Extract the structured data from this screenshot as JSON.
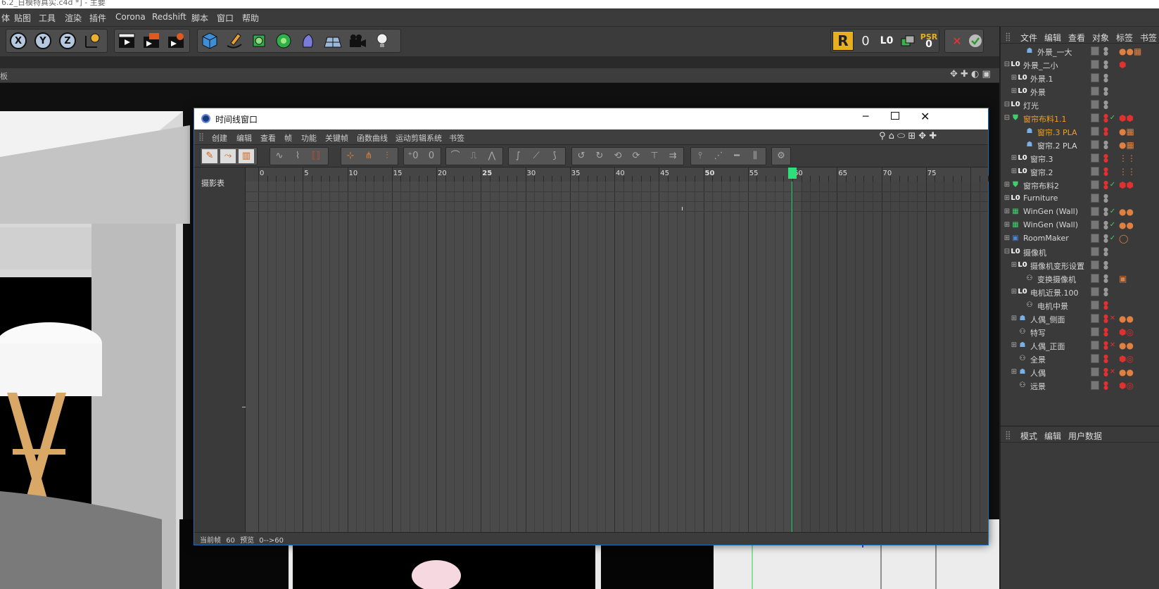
{
  "app": {
    "window_title": "6.2_日模特真实.c4d *] - 主要",
    "menus": [
      "体",
      "贴图",
      "工具",
      "渲染",
      "插件",
      "Corona",
      "Redshift",
      "脚本",
      "窗口",
      "帮助"
    ]
  },
  "toolbar": {
    "axis_x": "X",
    "axis_y": "Y",
    "axis_z": "Z",
    "right_group": {
      "frame_count": "0",
      "psr_label": "PSR",
      "psr_value": "0"
    }
  },
  "viewport": {
    "panel_label": "板"
  },
  "object_manager": {
    "menus": [
      "文件",
      "编辑",
      "查看",
      "对象",
      "标签",
      "书签"
    ],
    "items": [
      {
        "name": "外景_一大"
      },
      {
        "name": "外景_二小"
      },
      {
        "name": "外景.1"
      },
      {
        "name": "外景"
      },
      {
        "name": "灯光"
      },
      {
        "name": "窗帘布料1.1"
      },
      {
        "name": "窗帘.3 PLA"
      },
      {
        "name": "窗帘.2 PLA"
      },
      {
        "name": "窗帘.3"
      },
      {
        "name": "窗帘.2"
      },
      {
        "name": "窗帘布料2"
      },
      {
        "name": "Furniture"
      },
      {
        "name": "WinGen (Wall)"
      },
      {
        "name": "WinGen (Wall)"
      },
      {
        "name": "RoomMaker"
      },
      {
        "name": "摄像机"
      },
      {
        "name": "摄像机变形设置"
      },
      {
        "name": "变换摄像机"
      },
      {
        "name": "电机近景.100"
      },
      {
        "name": "电机中景"
      },
      {
        "name": "人偶_侧面"
      },
      {
        "name": "特写"
      },
      {
        "name": "人偶_正面"
      },
      {
        "name": "全景"
      },
      {
        "name": "人偶"
      },
      {
        "name": "远景"
      }
    ]
  },
  "attribute_manager": {
    "menus": [
      "模式",
      "编辑",
      "用户数据"
    ]
  },
  "timeline": {
    "title": "时间线窗口",
    "menus": [
      "创建",
      "编辑",
      "查看",
      "帧",
      "功能",
      "关键帧",
      "函数曲线",
      "运动剪辑系统",
      "书签"
    ],
    "left_label": "摄影表",
    "ruler_ticks": [
      "0",
      "5",
      "10",
      "15",
      "20",
      "25",
      "30",
      "35",
      "40",
      "45",
      "50",
      "55",
      "60",
      "65",
      "70",
      "75"
    ],
    "current_frame": "60",
    "status": {
      "current_frame_label": "当前帧",
      "current_frame_value": "60",
      "preview_label": "预览",
      "preview_range": "0-->60"
    }
  },
  "colors": {
    "accent_playhead": "#2ee07a",
    "window_border": "#1e6bb8",
    "orange_text": "#f0a020"
  }
}
